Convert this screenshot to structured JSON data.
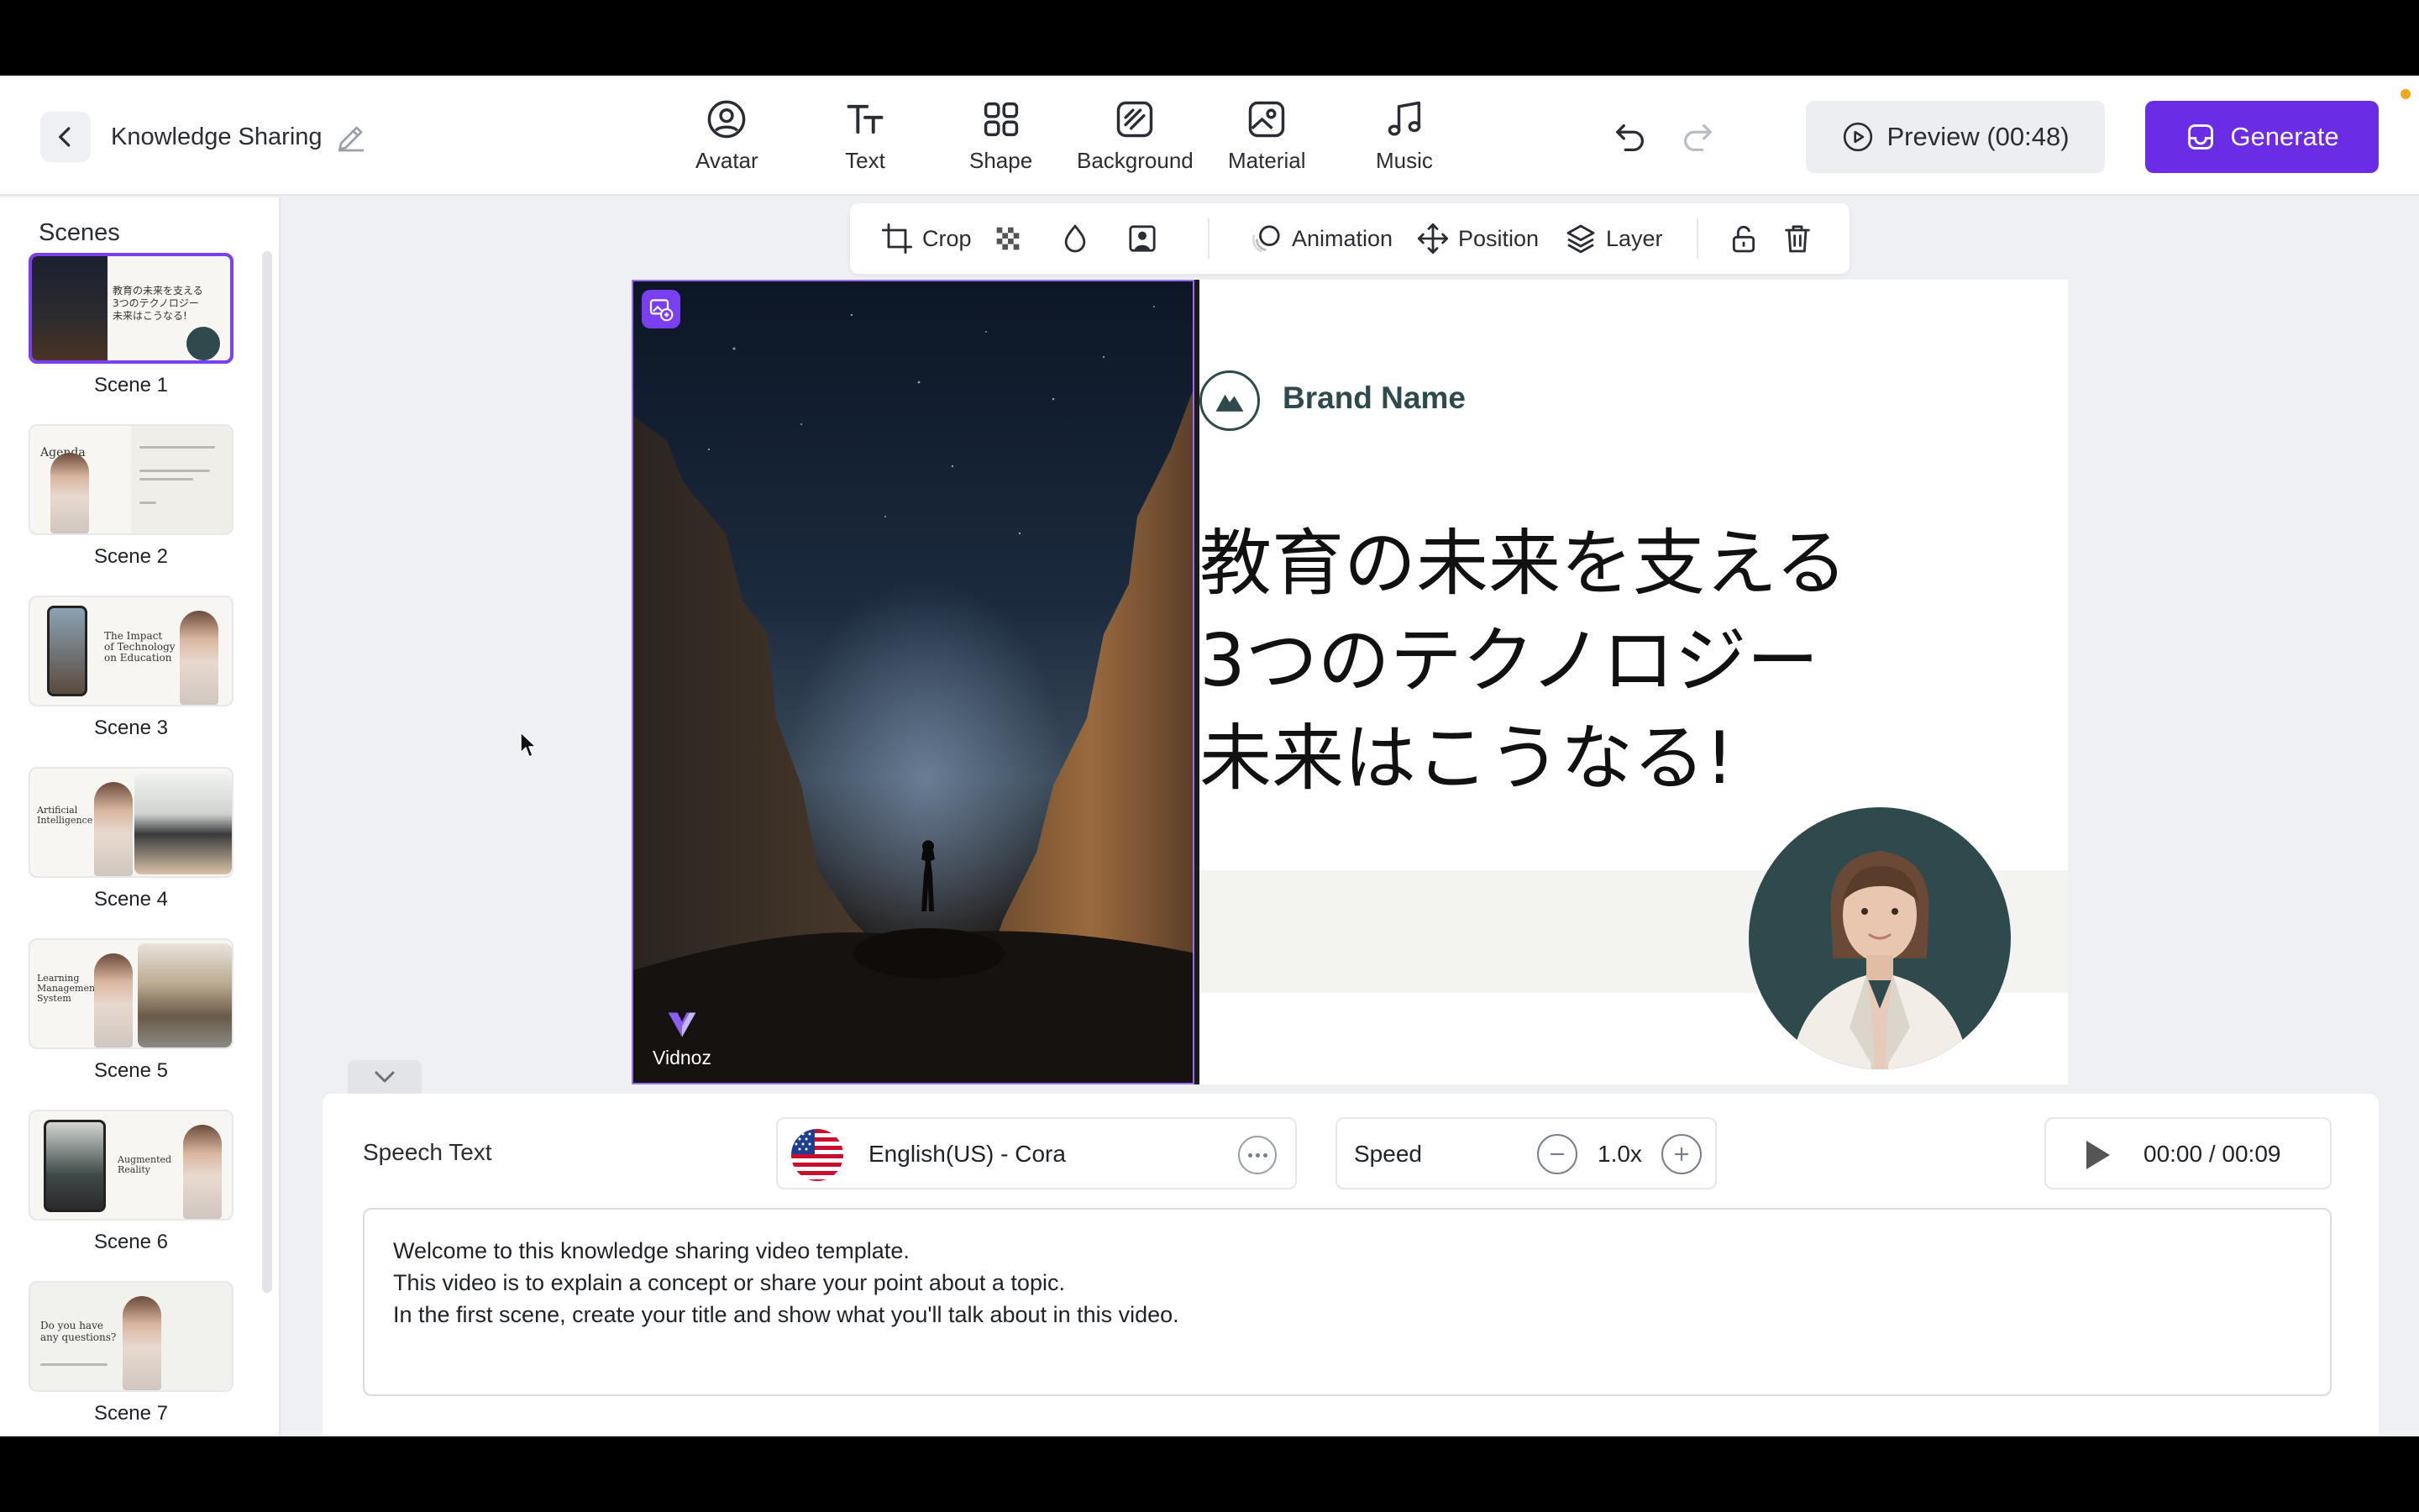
{
  "header": {
    "project_title": "Knowledge Sharing",
    "tools": [
      {
        "label": "Avatar",
        "icon": "avatar-icon"
      },
      {
        "label": "Text",
        "icon": "text-icon"
      },
      {
        "label": "Shape",
        "icon": "shape-icon"
      },
      {
        "label": "Background",
        "icon": "background-icon"
      },
      {
        "label": "Material",
        "icon": "material-icon"
      },
      {
        "label": "Music",
        "icon": "music-icon"
      }
    ],
    "preview_label": "Preview (00:48)",
    "generate_label": "Generate"
  },
  "sidebar": {
    "title": "Scenes",
    "scenes": [
      {
        "label": "Scene 1",
        "active": true
      },
      {
        "label": "Scene 2"
      },
      {
        "label": "Scene 3"
      },
      {
        "label": "Scene 4"
      },
      {
        "label": "Scene 5"
      },
      {
        "label": "Scene 6"
      },
      {
        "label": "Scene 7"
      }
    ]
  },
  "toolbar": {
    "crop_label": "Crop",
    "animation_label": "Animation",
    "position_label": "Position",
    "layer_label": "Layer"
  },
  "slide": {
    "brand_name": "Brand Name",
    "headline": "教育の未来を支える\n3つのテクノロジー\n未来はこうなる!",
    "watermark": "Vidnoz"
  },
  "speech": {
    "label": "Speech Text",
    "voice": "English(US) - Cora",
    "speed_label": "Speed",
    "speed_value": "1.0x",
    "time": "00:00 / 00:09",
    "text": "Welcome to this knowledge sharing video template.\nThis video is to explain a concept or share your point about a topic.\nIn the first scene, create your title and show what you'll talk about in this video."
  },
  "colors": {
    "accent": "#6b2ce6",
    "brand_teal": "#2e4a4d",
    "canvas_bg": "#eff0f3"
  }
}
